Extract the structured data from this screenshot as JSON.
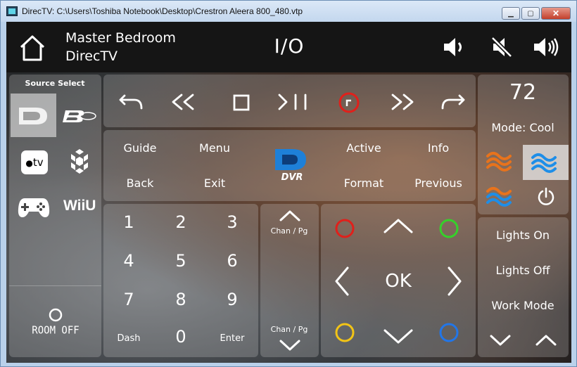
{
  "window": {
    "title": "DirecTV: C:\\Users\\Toshiba Notebook\\Desktop\\Crestron Aleera 800_480.vtp"
  },
  "header": {
    "room": "Master Bedroom",
    "source": "DirecTV",
    "power_label": "I/O"
  },
  "source_select": {
    "title": "Source Select",
    "room_off": "ROOM OFF",
    "sources": [
      "directv-icon",
      "bluray-icon",
      "appletv-icon",
      "hexagon-app-icon",
      "gamepad-icon",
      "wii-u-icon"
    ],
    "wii_label": "WiiU",
    "appletv_label": "tv"
  },
  "menu": {
    "guide": "Guide",
    "menu": "Menu",
    "active": "Active",
    "info": "Info",
    "back": "Back",
    "exit": "Exit",
    "format": "Format",
    "previous": "Previous",
    "dvr_label": "DVR"
  },
  "keypad": {
    "keys": [
      "1",
      "2",
      "3",
      "4",
      "5",
      "6",
      "7",
      "8",
      "9",
      "0"
    ],
    "dash": "Dash",
    "enter": "Enter"
  },
  "channel": {
    "up": "Chan / Pg",
    "down": "Chan / Pg"
  },
  "dpad": {
    "ok": "OK"
  },
  "climate": {
    "temperature": "72",
    "mode": "Mode: Cool"
  },
  "lights": {
    "on": "Lights On",
    "off": "Lights Off",
    "work": "Work Mode"
  },
  "colors": {
    "red": "#e0201b",
    "green": "#35d12a",
    "yellow": "#f2c416",
    "blue": "#2276e8",
    "accent_bg": "#151515"
  }
}
